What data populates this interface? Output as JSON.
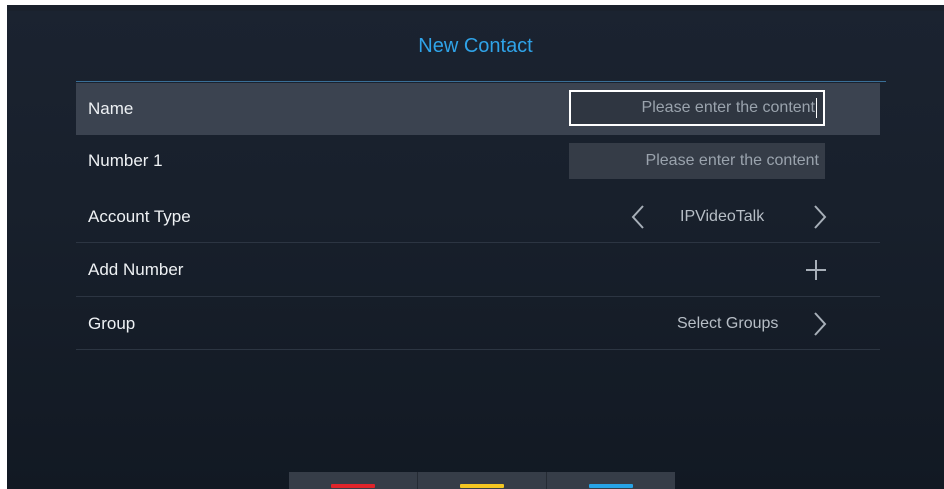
{
  "header": {
    "title": "New Contact"
  },
  "rows": [
    {
      "label": "Name",
      "placeholder": "Please enter the content"
    },
    {
      "label": "Number 1",
      "placeholder": "Please enter the content"
    },
    {
      "label": "Account Type",
      "value": "IPVideoTalk"
    },
    {
      "label": "Add Number"
    },
    {
      "label": "Group",
      "value": "Select Groups"
    }
  ],
  "softkeys": [
    {
      "color": "#e0242b",
      "name": "red"
    },
    {
      "color": "#f3c622",
      "name": "yellow"
    },
    {
      "color": "#27a3e6",
      "name": "blue"
    }
  ],
  "colors": {
    "accent": "#2fa3e8",
    "background": "#18202c",
    "selected_row": "#3b4350"
  }
}
